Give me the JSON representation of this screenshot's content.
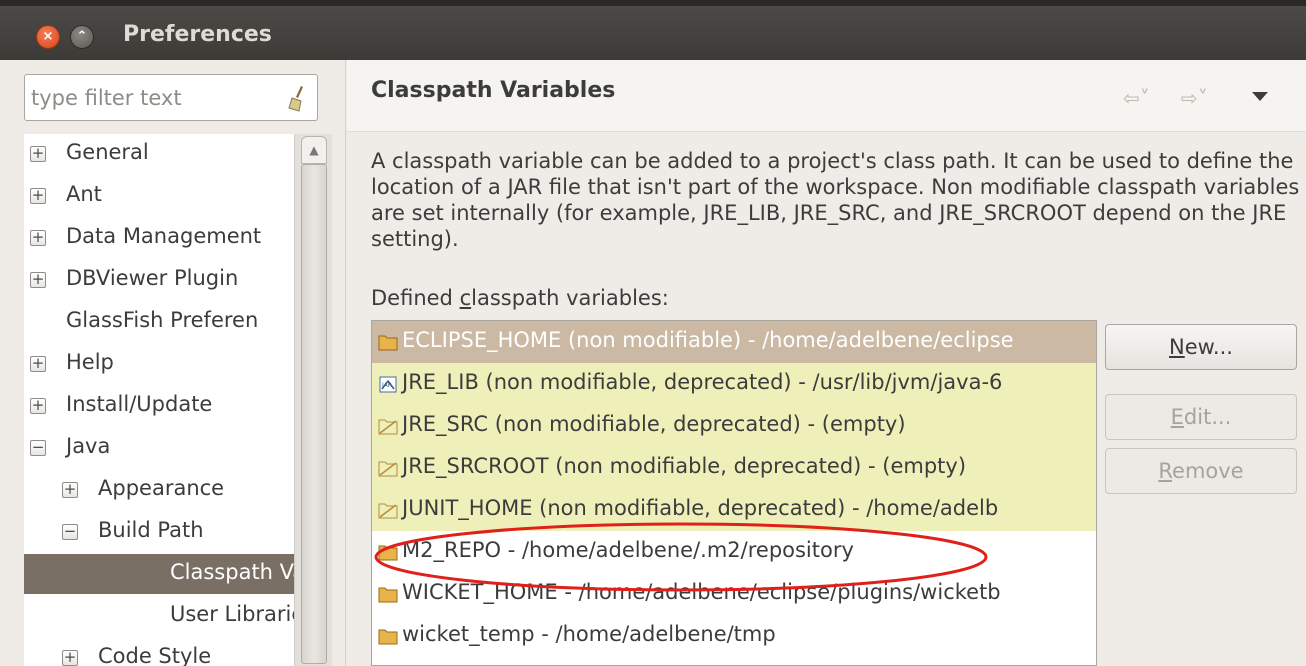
{
  "window": {
    "title": "Preferences",
    "close_glyph": "×",
    "minimize_glyph": "⌃"
  },
  "filter": {
    "placeholder": "type filter text"
  },
  "tree": {
    "expanded_glyph": "−",
    "collapsed_glyph": "+",
    "items": [
      {
        "label": "General",
        "state": "collapsed"
      },
      {
        "label": "Ant",
        "state": "collapsed"
      },
      {
        "label": "Data Management",
        "state": "collapsed"
      },
      {
        "label": "DBViewer Plugin",
        "state": "collapsed"
      },
      {
        "label": "GlassFish Preferen",
        "state": "leaf"
      },
      {
        "label": "Help",
        "state": "collapsed"
      },
      {
        "label": "Install/Update",
        "state": "collapsed"
      },
      {
        "label": "Java",
        "state": "expanded"
      },
      {
        "label": "Appearance",
        "state": "collapsed"
      },
      {
        "label": "Build Path",
        "state": "expanded"
      },
      {
        "label": "Classpath Va",
        "state": "leaf",
        "selected": true
      },
      {
        "label": "User Libraries",
        "state": "leaf"
      },
      {
        "label": "Code Style",
        "state": "collapsed"
      }
    ]
  },
  "page": {
    "title": "Classpath Variables",
    "description": "A classpath variable can be added to a project's class path. It can be used to define the location of a JAR file that isn't part of the workspace. Non modifiable classpath variables are set internally (for example, JRE_LIB, JRE_SRC, and JRE_SRCROOT depend on the JRE setting).",
    "defined_label_pre": "Defined ",
    "defined_label_mnemonic": "c",
    "defined_label_post": "lasspath variables:",
    "nav_back": "⇦˅",
    "nav_forward": "⇨˅"
  },
  "variables": [
    {
      "text": "ECLIPSE_HOME (non modifiable) - /home/adelbene/eclipse",
      "icon": "folder-icon",
      "readonly": true,
      "selected": true
    },
    {
      "text": "JRE_LIB (non modifiable, deprecated) - /usr/lib/jvm/java-6",
      "icon": "jar-icon",
      "readonly": true
    },
    {
      "text": "JRE_SRC (non modifiable, deprecated) - (empty)",
      "icon": "deprecated-folder-icon",
      "readonly": true
    },
    {
      "text": "JRE_SRCROOT (non modifiable, deprecated) - (empty)",
      "icon": "deprecated-folder-icon",
      "readonly": true
    },
    {
      "text": "JUNIT_HOME (non modifiable, deprecated) - /home/adelb",
      "icon": "deprecated-folder-icon",
      "readonly": true
    },
    {
      "text": "M2_REPO - /home/adelbene/.m2/repository",
      "icon": "folder-icon",
      "readonly": false
    },
    {
      "text": "WICKET_HOME - /home/adelbene/eclipse/plugins/wicketb",
      "icon": "folder-icon",
      "readonly": false
    },
    {
      "text": "wicket_temp - /home/adelbene/tmp",
      "icon": "folder-icon",
      "readonly": false
    }
  ],
  "buttons": {
    "new_mnemonic": "N",
    "new_rest": "ew...",
    "edit_mnemonic": "E",
    "edit_rest": "dit...",
    "remove_mnemonic": "R",
    "remove_rest": "emove"
  },
  "colors": {
    "highlight_ellipse": "#e0201b",
    "selection": "#7a6f65",
    "readonly_row": "#eff0b9"
  }
}
